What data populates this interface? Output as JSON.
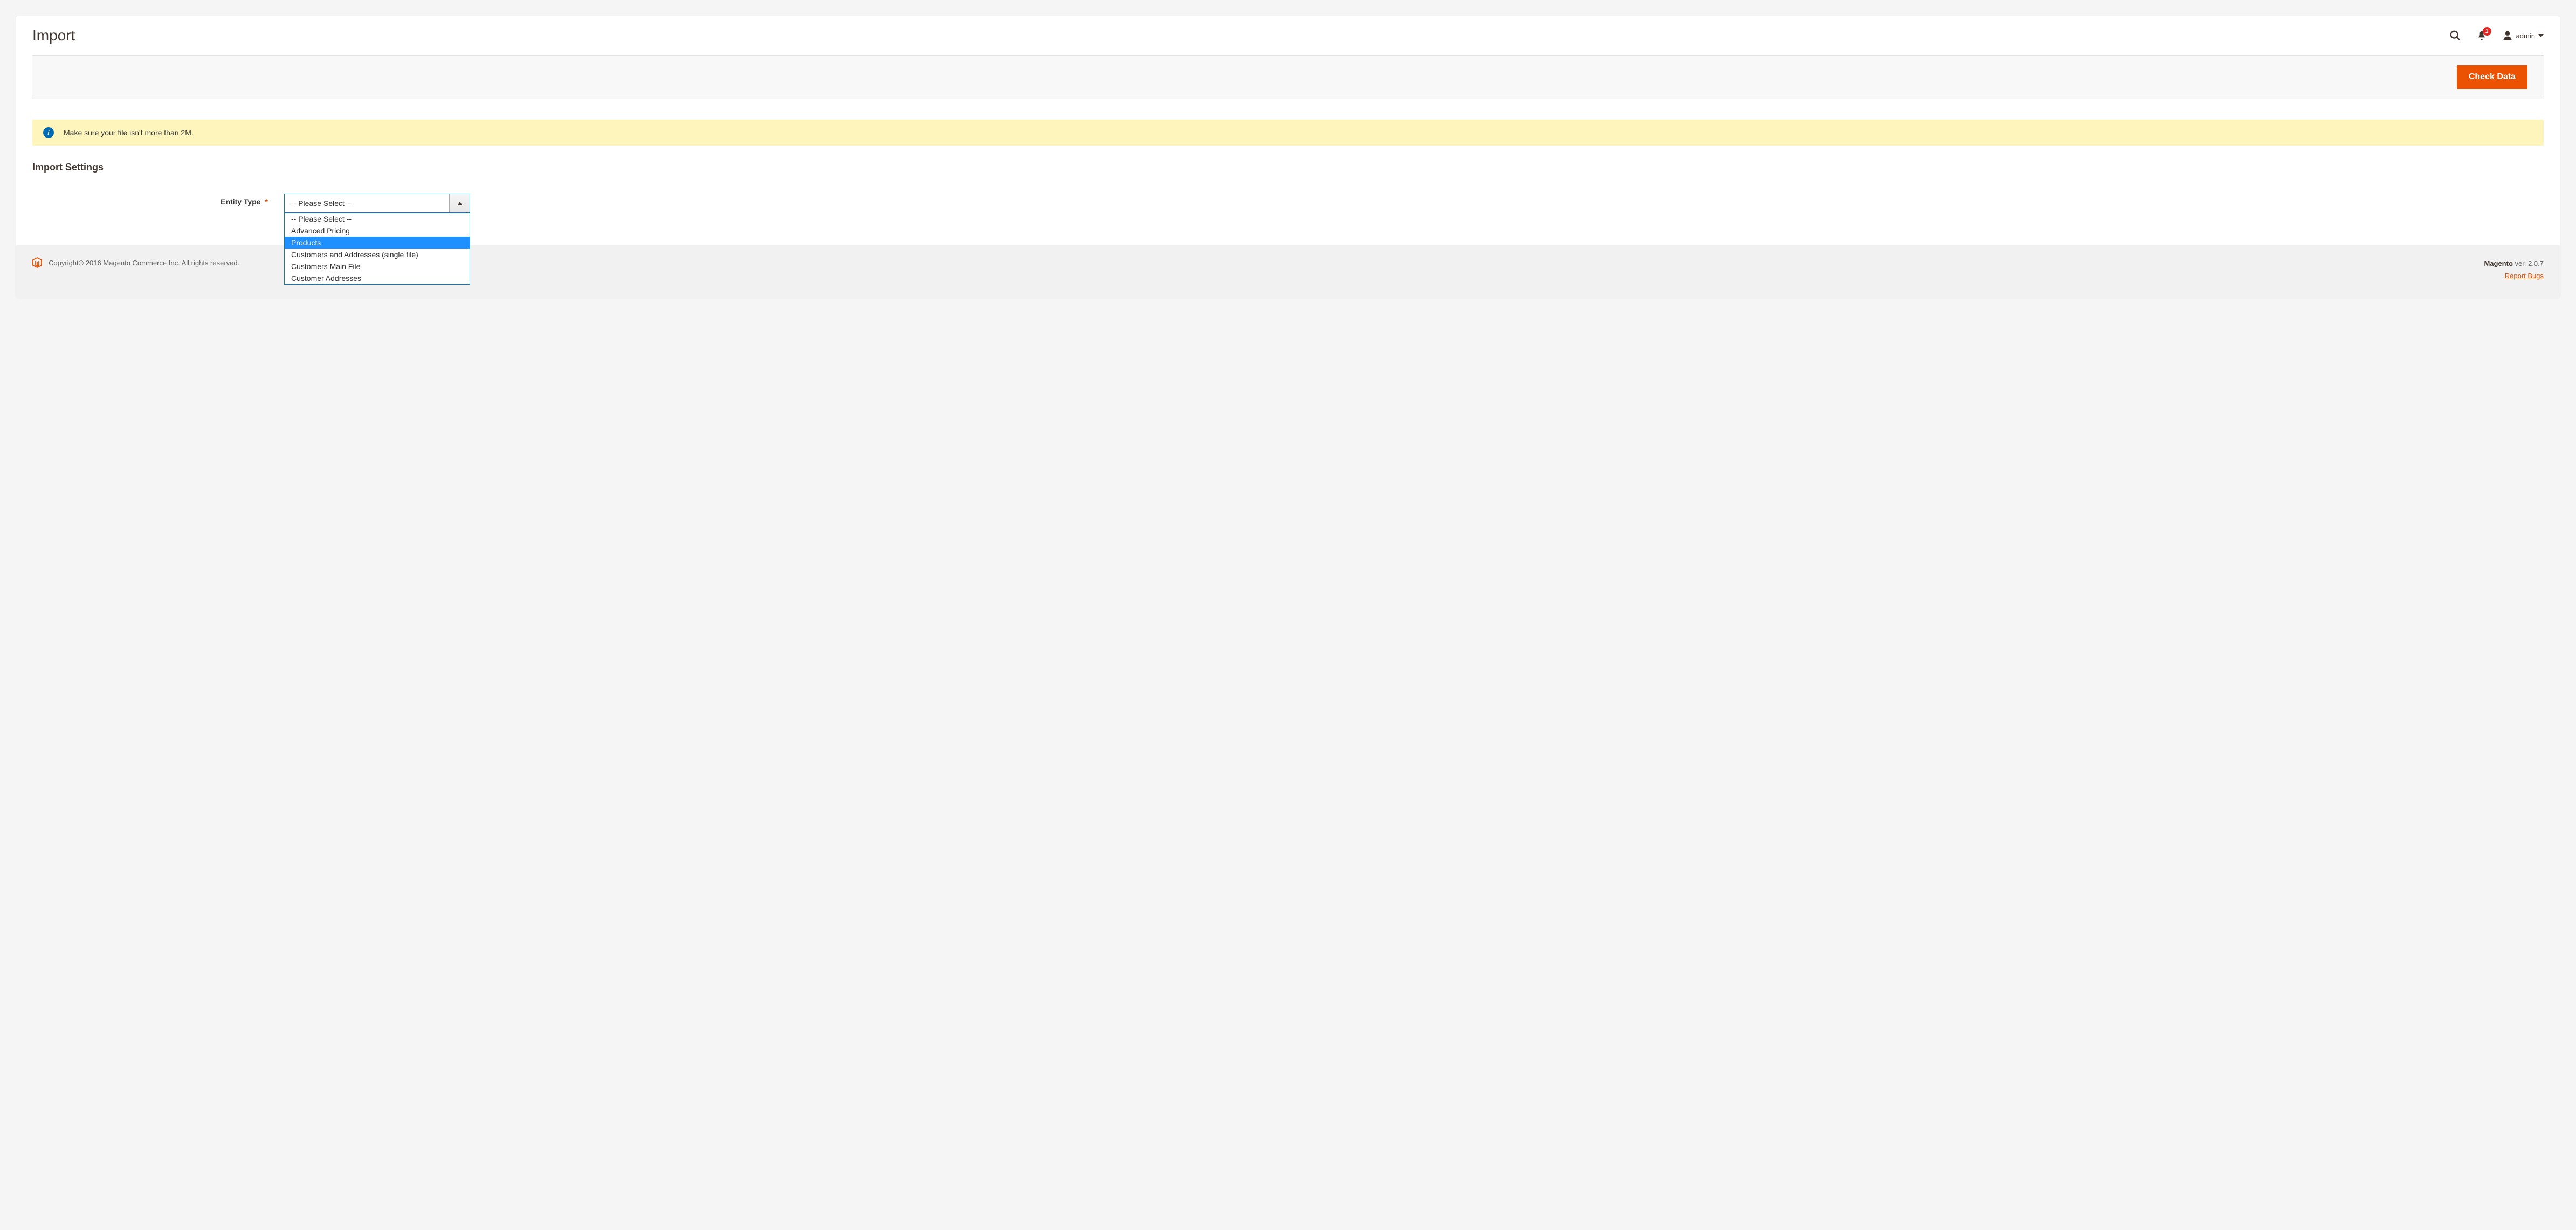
{
  "header": {
    "title": "Import",
    "notification_count": "1",
    "account_name": "admin"
  },
  "action_bar": {
    "check_data_label": "Check Data"
  },
  "notice": {
    "text": "Make sure your file isn't more than 2M."
  },
  "section": {
    "title": "Import Settings"
  },
  "form": {
    "entity_type_label": "Entity Type",
    "entity_type_selected": "-- Please Select --",
    "entity_type_options": [
      "-- Please Select --",
      "Advanced Pricing",
      "Products",
      "Customers and Addresses (single file)",
      "Customers Main File",
      "Customer Addresses"
    ],
    "entity_type_highlighted_index": 2
  },
  "footer": {
    "copyright": "Copyright© 2016 Magento Commerce Inc. All rights reserved.",
    "brand": "Magento",
    "version": " ver. 2.0.7",
    "report_bugs": "Report Bugs"
  }
}
